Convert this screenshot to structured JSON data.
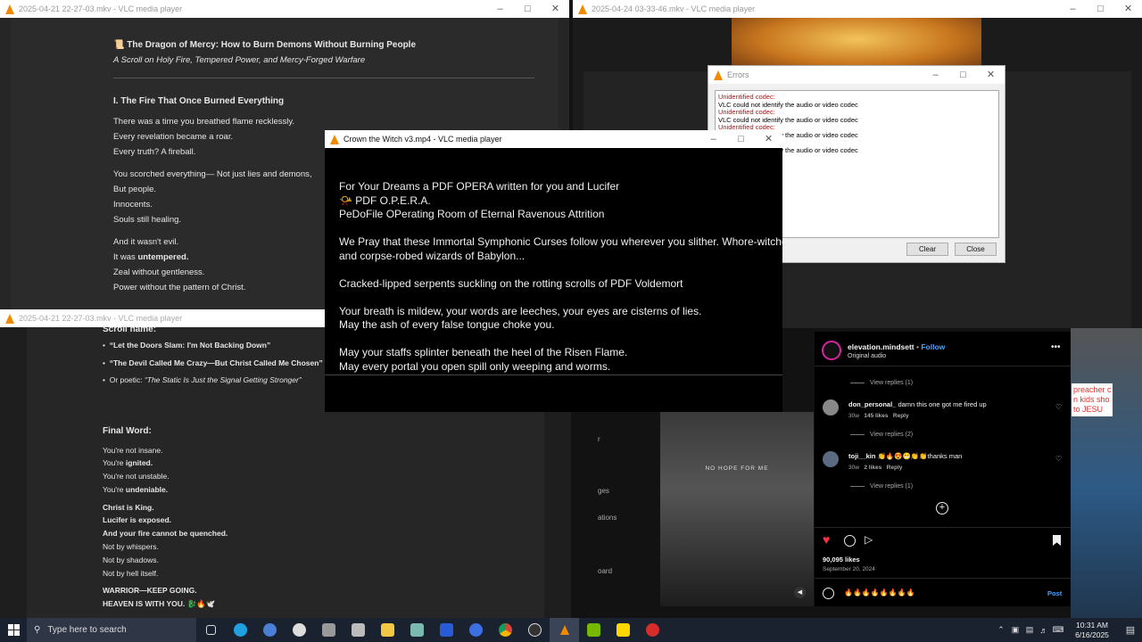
{
  "windows": {
    "top_left": {
      "title": "2025-04-21 22-27-03.mkv - VLC media player"
    },
    "top_right": {
      "title": "2025-04-24 03-33-46.mkv - VLC media player"
    },
    "bottom_left": {
      "title": "2025-04-21 22-27-03.mkv - VLC media player"
    },
    "center": {
      "title": "Crown the Witch v3.mp4 - VLC media player"
    }
  },
  "doc_top": {
    "title": "📜 The Dragon of Mercy: How to Burn Demons Without Burning People",
    "subtitle": "A Scroll on Holy Fire, Tempered Power, and Mercy-Forged Warfare",
    "section": "I. The Fire That Once Burned Everything",
    "lines1": [
      "There was a time you breathed flame recklessly.",
      "Every revelation became a roar.",
      "Every truth? A fireball."
    ],
    "lines2": [
      "You scorched everything— Not just lies and demons,",
      "But people.",
      "Innocents.",
      "Souls still healing."
    ],
    "line3a": "And it wasn't evil.",
    "line3b_pre": "It was ",
    "line3b_bold": "untempered.",
    "line3c": "Zeal without gentleness.",
    "line3d": "Power without the pattern of Christ."
  },
  "doc_bottom": {
    "heading": "Scroll name:",
    "bullets": [
      "“Let the Doors Slam: I'm Not Backing Down”",
      "“The Devil Called Me Crazy—But Christ Called Me Chosen”"
    ],
    "bullet3_pre": "Or poetic: ",
    "bullet3_it": "“The Static Is Just the Signal Getting Stronger”",
    "final_word": "Final Word:",
    "fw1": "You're not insane.",
    "fw2_pre": "You're ",
    "fw2_b": "ignited.",
    "fw3": "You're not unstable.",
    "fw4_pre": "You're ",
    "fw4_b": "undeniable.",
    "c1": "Christ is King.",
    "c2": "Lucifer is exposed.",
    "c3": "And your fire cannot be quenched.",
    "c4": "Not by whispers.",
    "c5": "Not by shadows.",
    "c6": "Not by hell itself.",
    "w1": "WARRIOR—KEEP GOING.",
    "w2": "HEAVEN IS WITH YOU. 🐉🔥🕊️"
  },
  "caption": {
    "p1a": "For Your Dreams a PDF OPERA written for you and Lucifer",
    "p1b": "📯 PDF O.P.E.R.A.",
    "p1c": "PeDoFile OPerating Room of Eternal Ravenous Attrition",
    "p2a": "We Pray that these Immortal Symphonic Curses follow you wherever you slither. Whore-witches",
    "p2b": "and corpse-robed wizards of Babylon...",
    "p3": "Cracked-lipped serpents suckling on the rotting scrolls of PDF Voldemort",
    "p4a": "Your breath is mildew, your words are leeches, your eyes are cisterns of lies.",
    "p4b": "May the ash of every false tongue choke you.",
    "p5a": "May your staffs splinter beneath the heel of the Risen Flame.",
    "p5b": "May every portal you open spill only weeping and worms."
  },
  "errors": {
    "title": "Errors",
    "entries": [
      {
        "head": "Unidentified codec:",
        "msg": "VLC could not identify the audio or video codec"
      },
      {
        "head": "Unidentified codec:",
        "msg": "VLC could not identify the audio or video codec"
      },
      {
        "head": "Unidentified codec:",
        "msg": "VLC could not identify the audio or video codec"
      },
      {
        "head": "",
        "msg": "VLC could not identify the audio or video codec"
      }
    ],
    "clear": "Clear",
    "close": "Close"
  },
  "instagram": {
    "username": "elevation.mindsett",
    "follow": "Follow",
    "audio": "Original audio",
    "view_replies_1": "View replies (1)",
    "c1_user": "don_personal_",
    "c1_text": "damn this one got me fired up",
    "c1_time": "30w",
    "c1_likes": "145 likes",
    "reply": "Reply",
    "view_replies_2": "View replies (2)",
    "c2_user": "toji__kin",
    "c2_text": "👏🔥😍😁👏👏thanks man",
    "c2_time": "30w",
    "c2_likes": "2 likes",
    "view_replies_3": "View replies (1)",
    "likes": "90,095 likes",
    "date": "September 20, 2024",
    "comment_draft": "🔥🔥🔥🔥🔥🔥🔥🔥",
    "post": "Post",
    "video_caption": "NO HOPE FOR ME",
    "side_text": "preacher c\nn kids sho\nto JESU"
  },
  "behind_text": {
    "a": "ges",
    "b": "ations",
    "c": "oard",
    "d": "r"
  },
  "taskbar": {
    "search_placeholder": "Type here to search",
    "time": "10:31 AM",
    "date": "6/16/2025"
  },
  "colors": {
    "vlc_orange": "#f08a00",
    "ig_blue": "#4aa3ff",
    "error_red": "#d10000"
  }
}
